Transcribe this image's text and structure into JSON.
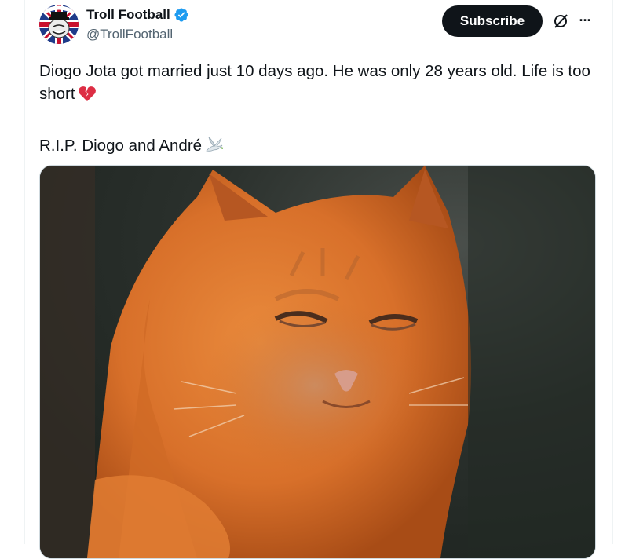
{
  "author": {
    "display_name": "Troll Football",
    "handle": "@TrollFootball",
    "verified_icon": "verified-badge-icon",
    "avatar_text": "SUCCER"
  },
  "actions": {
    "subscribe_label": "Subscribe",
    "grok_icon": "grok-icon",
    "more_icon": "more-options-icon",
    "more_label": "···"
  },
  "tweet": {
    "line1": "Diogo Jota got married just 10 days ago. He was only 28 years old. Life is too short",
    "line1_emoji": "broken-heart-emoji",
    "line2": "R.I.P. Diogo and André",
    "line2_emoji": "dove-emoji"
  },
  "media": {
    "type": "video-thumbnail",
    "subject": "orange-cat"
  },
  "colors": {
    "text": "#0f1419",
    "secondary": "#536471",
    "verified": "#1d9bf0",
    "button_bg": "#0f1419"
  }
}
